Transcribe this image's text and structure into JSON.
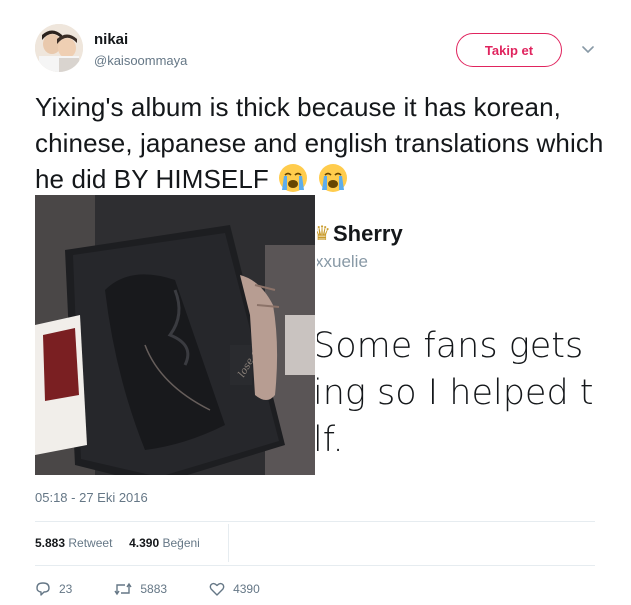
{
  "tweet": {
    "user": {
      "name": "nikai",
      "handle": "@kaisoommaya",
      "avatar_icon": "avatar"
    },
    "follow_label": "Takip et",
    "text": "Yixing's album is thick because it has korean, chinese, japanese and english translations which he did BY HIMSELF",
    "emojis": [
      "loudly-crying-face",
      "loudly-crying-face"
    ],
    "embedded_screenshot": {
      "name": "Sherry",
      "handle": "xxuelie",
      "lines": [
        "Some fans gets ti",
        "ing so I helped th",
        "lf."
      ]
    },
    "timestamp": "05:18 - 27 Eki 2016",
    "stats": {
      "retweets_count": "5.883",
      "retweets_label": "Retweet",
      "likes_count": "4.390",
      "likes_label": "Beğeni"
    },
    "actions": {
      "reply_count": "23",
      "retweet_count": "5883",
      "like_count": "4390"
    }
  },
  "colors": {
    "accent": "#e0245e",
    "text": "#14171a",
    "muted": "#657786",
    "divider": "#e6ecf0"
  }
}
